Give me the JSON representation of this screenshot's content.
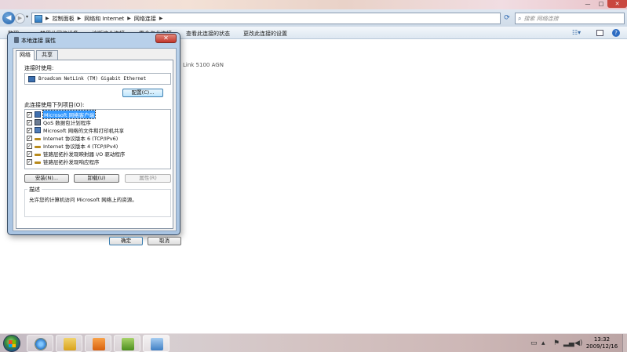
{
  "explorer": {
    "breadcrumbs": [
      "控制面板",
      "网络和 Internet",
      "网络连接"
    ],
    "search_placeholder": "搜索 网络连接",
    "toolbar": [
      "整理 ▾",
      "禁用此网络设备",
      "诊断这个连接",
      "重命名此连接",
      "查看此连接的状态",
      "更改此连接的设置"
    ],
    "content": {
      "adapter_partial_text": "Link 5100 AGN"
    }
  },
  "dialog": {
    "title": "本地连接 属性",
    "tabs": [
      "网络",
      "共享"
    ],
    "connect_using_label": "连接时使用:",
    "adapter_name": "Broadcom NetLink (TM) Gigabit Ethernet",
    "configure_button": "配置(C)...",
    "items_label": "此连接使用下列项目(O):",
    "items": [
      {
        "label": "Microsoft 网络客户端",
        "checked": true,
        "icon": "network-client-icon",
        "selected": true
      },
      {
        "label": "QoS 数据包计划程序",
        "checked": true,
        "icon": "qos-scheduler-icon",
        "selected": false
      },
      {
        "label": "Microsoft 网络的文件和打印机共享",
        "checked": true,
        "icon": "file-printer-sharing-icon",
        "selected": false
      },
      {
        "label": "Internet 协议版本 6 (TCP/IPv6)",
        "checked": true,
        "icon": "protocol-icon",
        "selected": false
      },
      {
        "label": "Internet 协议版本 4 (TCP/IPv4)",
        "checked": true,
        "icon": "protocol-icon",
        "selected": false
      },
      {
        "label": "链路层拓扑发现映射器 I/O 驱动程序",
        "checked": true,
        "icon": "protocol-icon",
        "selected": false
      },
      {
        "label": "链路层拓扑发现响应程序",
        "checked": true,
        "icon": "protocol-icon",
        "selected": false
      }
    ],
    "install_button": "安装(N)...",
    "uninstall_button": "卸载(U)",
    "properties_button": "属性(R)",
    "description_legend": "描述",
    "description_text": "允许您的计算机访问 Microsoft 网络上的资源。",
    "ok_button": "确定",
    "cancel_button": "取消"
  },
  "taskbar": {
    "apps": [
      "internet-explorer-icon",
      "windows-explorer-icon",
      "media-player-icon",
      "download-manager-icon",
      "network-connections-icon"
    ],
    "clock_time": "13:32",
    "clock_date": "2009/12/16"
  }
}
